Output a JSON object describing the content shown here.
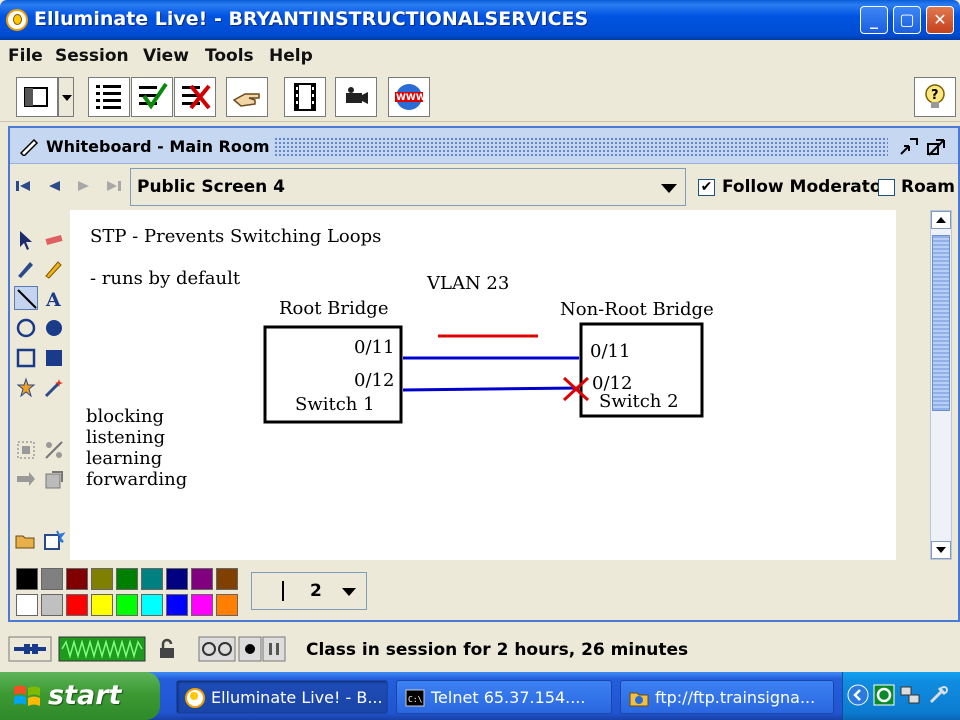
{
  "window": {
    "title": "Elluminate Live! - BRYANTINSTRUCTIONALSERVICES",
    "controls": [
      "minimize",
      "maximize",
      "close"
    ]
  },
  "menu": [
    "File",
    "Session",
    "View",
    "Tools",
    "Help"
  ],
  "toolbar": {
    "buttons": [
      "layout-icon",
      "participant-list-icon",
      "approve-icon",
      "disapprove-icon",
      "raise-hand-icon",
      "application-share-icon",
      "video-icon",
      "web-tour-icon",
      "help-bulb-icon"
    ]
  },
  "whiteboard": {
    "title": "Whiteboard - Main Room",
    "screen": "Public Screen 4",
    "follow_moderator_label": "Follow Moderator",
    "follow_moderator_checked": true,
    "roam_label": "Roam",
    "roam_checked": false,
    "line_width": "2",
    "colors": [
      "#000000",
      "#808080",
      "#800000",
      "#808000",
      "#008000",
      "#008080",
      "#000080",
      "#800080",
      "#804000",
      "#ffffff",
      "#c0c0c0",
      "#ff0000",
      "#ffff00",
      "#00ff00",
      "#00ffff",
      "#0000ff",
      "#ff00ff",
      "#ff8000"
    ],
    "content": {
      "heading": "STP - Prevents Switching Loops",
      "note": "- runs by default",
      "vlan": "VLAN 23",
      "root_label": "Root Bridge",
      "nonroot_label": "Non-Root Bridge",
      "root_port1": "0/11",
      "root_port2": "0/12",
      "root_switch": "Switch 1",
      "nonroot_port1": "0/11",
      "nonroot_port2": "0/12",
      "nonroot_switch": "Switch 2",
      "states": [
        "blocking",
        "listening",
        "learning",
        "forwarding"
      ],
      "line_color": "#0000cc",
      "mark_color": "#e00000"
    }
  },
  "status": {
    "text": "Class in session for 2 hours, 26 minutes"
  },
  "taskbar": {
    "start": "start",
    "tasks": [
      "Elluminate Live! - B...",
      "Telnet 65.37.154....",
      "ftp://ftp.trainsigna..."
    ]
  }
}
